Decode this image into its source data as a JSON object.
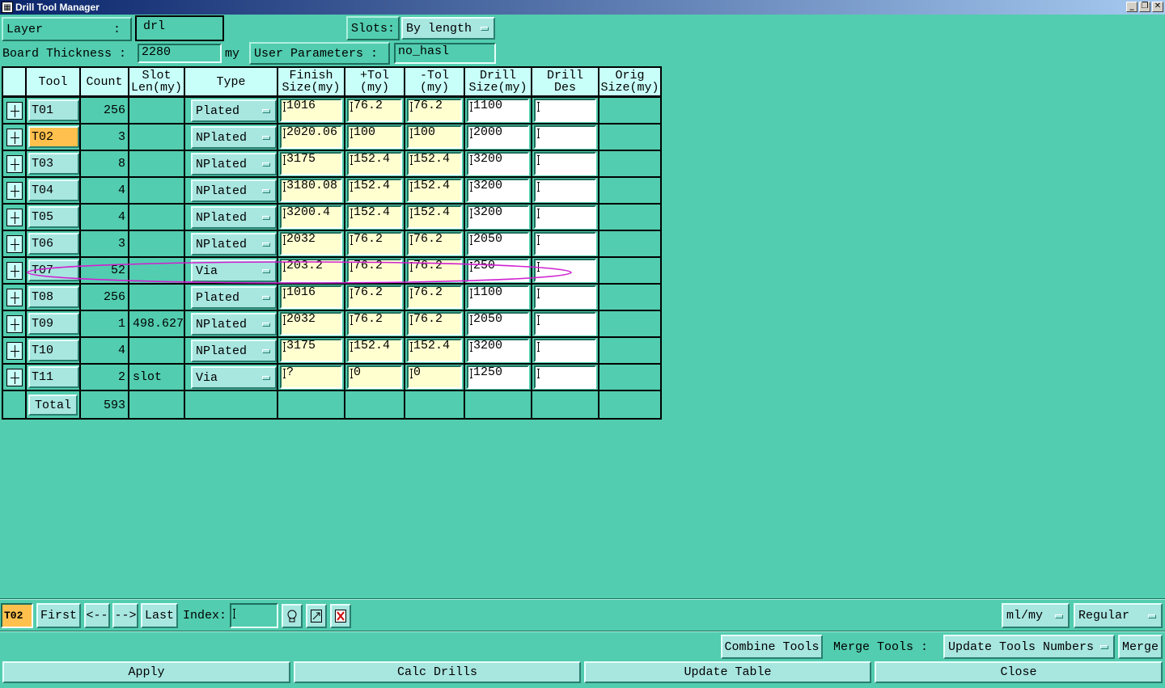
{
  "window": {
    "title": "Drill Tool Manager"
  },
  "top": {
    "layer_label": "Layer",
    "layer_colon": ":",
    "layer_value": "drl",
    "slots_label": "Slots:",
    "slots_value": "By length",
    "board_thickness_label": "Board Thickness :",
    "board_thickness_value": "2280",
    "board_thickness_unit": "my",
    "user_params_label": "User Parameters :",
    "user_params_value": "no_hasl"
  },
  "table": {
    "headers": {
      "tool": "Tool",
      "count": "Count",
      "slot1": "Slot",
      "slot2": "Len(my)",
      "type": "Type",
      "finish1": "Finish",
      "finish2": "Size(my)",
      "ptol1": "+Tol",
      "ptol2": "(my)",
      "mtol1": "-Tol",
      "mtol2": "(my)",
      "drill1": "Drill",
      "drill2": "Size(my)",
      "des1": "Drill",
      "des2": "Des",
      "orig1": "Orig",
      "orig2": "Size(my)"
    },
    "rows": [
      {
        "tool": "T01",
        "count": "256",
        "slot": "",
        "type": "Plated",
        "finish": "1016",
        "ptol": "76.2",
        "mtol": "76.2",
        "drill": "1100",
        "des": ""
      },
      {
        "tool": "T02",
        "count": "3",
        "slot": "",
        "type": "NPlated",
        "finish": "2020.06",
        "ptol": "100",
        "mtol": "100",
        "drill": "2000",
        "des": ""
      },
      {
        "tool": "T03",
        "count": "8",
        "slot": "",
        "type": "NPlated",
        "finish": "3175",
        "ptol": "152.4",
        "mtol": "152.4",
        "drill": "3200",
        "des": ""
      },
      {
        "tool": "T04",
        "count": "4",
        "slot": "",
        "type": "NPlated",
        "finish": "3180.08",
        "ptol": "152.4",
        "mtol": "152.4",
        "drill": "3200",
        "des": ""
      },
      {
        "tool": "T05",
        "count": "4",
        "slot": "",
        "type": "NPlated",
        "finish": "3200.4",
        "ptol": "152.4",
        "mtol": "152.4",
        "drill": "3200",
        "des": ""
      },
      {
        "tool": "T06",
        "count": "3",
        "slot": "",
        "type": "NPlated",
        "finish": "2032",
        "ptol": "76.2",
        "mtol": "76.2",
        "drill": "2050",
        "des": ""
      },
      {
        "tool": "T07",
        "count": "52",
        "slot": "",
        "type": "Via",
        "finish": "203.2",
        "ptol": "76.2",
        "mtol": "76.2",
        "drill": "250",
        "des": ""
      },
      {
        "tool": "T08",
        "count": "256",
        "slot": "",
        "type": "Plated",
        "finish": "1016",
        "ptol": "76.2",
        "mtol": "76.2",
        "drill": "1100",
        "des": ""
      },
      {
        "tool": "T09",
        "count": "1",
        "slot": "498.627",
        "type": "NPlated",
        "finish": "2032",
        "ptol": "76.2",
        "mtol": "76.2",
        "drill": "2050",
        "des": ""
      },
      {
        "tool": "T10",
        "count": "4",
        "slot": "",
        "type": "NPlated",
        "finish": "3175",
        "ptol": "152.4",
        "mtol": "152.4",
        "drill": "3200",
        "des": ""
      },
      {
        "tool": "T11",
        "count": "2",
        "slot": "slot",
        "type": "Via",
        "finish": "?",
        "ptol": "0",
        "mtol": "0",
        "drill": "1250",
        "des": ""
      }
    ],
    "total_label": "Total",
    "total_count": "593"
  },
  "nav": {
    "current_tool": "T02",
    "first": "First",
    "prev": "<--",
    "next": "-->",
    "last": "Last",
    "index_label": "Index:",
    "index_value": "",
    "units": "ml/my",
    "mode": "Regular"
  },
  "actions": {
    "combine_tools": "Combine Tools",
    "merge_tools_label": "Merge Tools :",
    "merge_tools_option": "Update Tools Numbers",
    "merge": "Merge",
    "apply": "Apply",
    "calc_drills": "Calc Drills",
    "update_table": "Update Table",
    "close": "Close"
  },
  "colors": {
    "background": "#52cdaf",
    "header_cell": "#c8fff8",
    "input_yellow": "#ffffd0",
    "selected_tool": "#ffc04d",
    "annotation_ellipse": "#d020d0"
  },
  "icons": [
    "expand-plus-icon",
    "lightbulb-icon",
    "export-icon",
    "delete-icon",
    "dropdown-indicator-icon"
  ]
}
